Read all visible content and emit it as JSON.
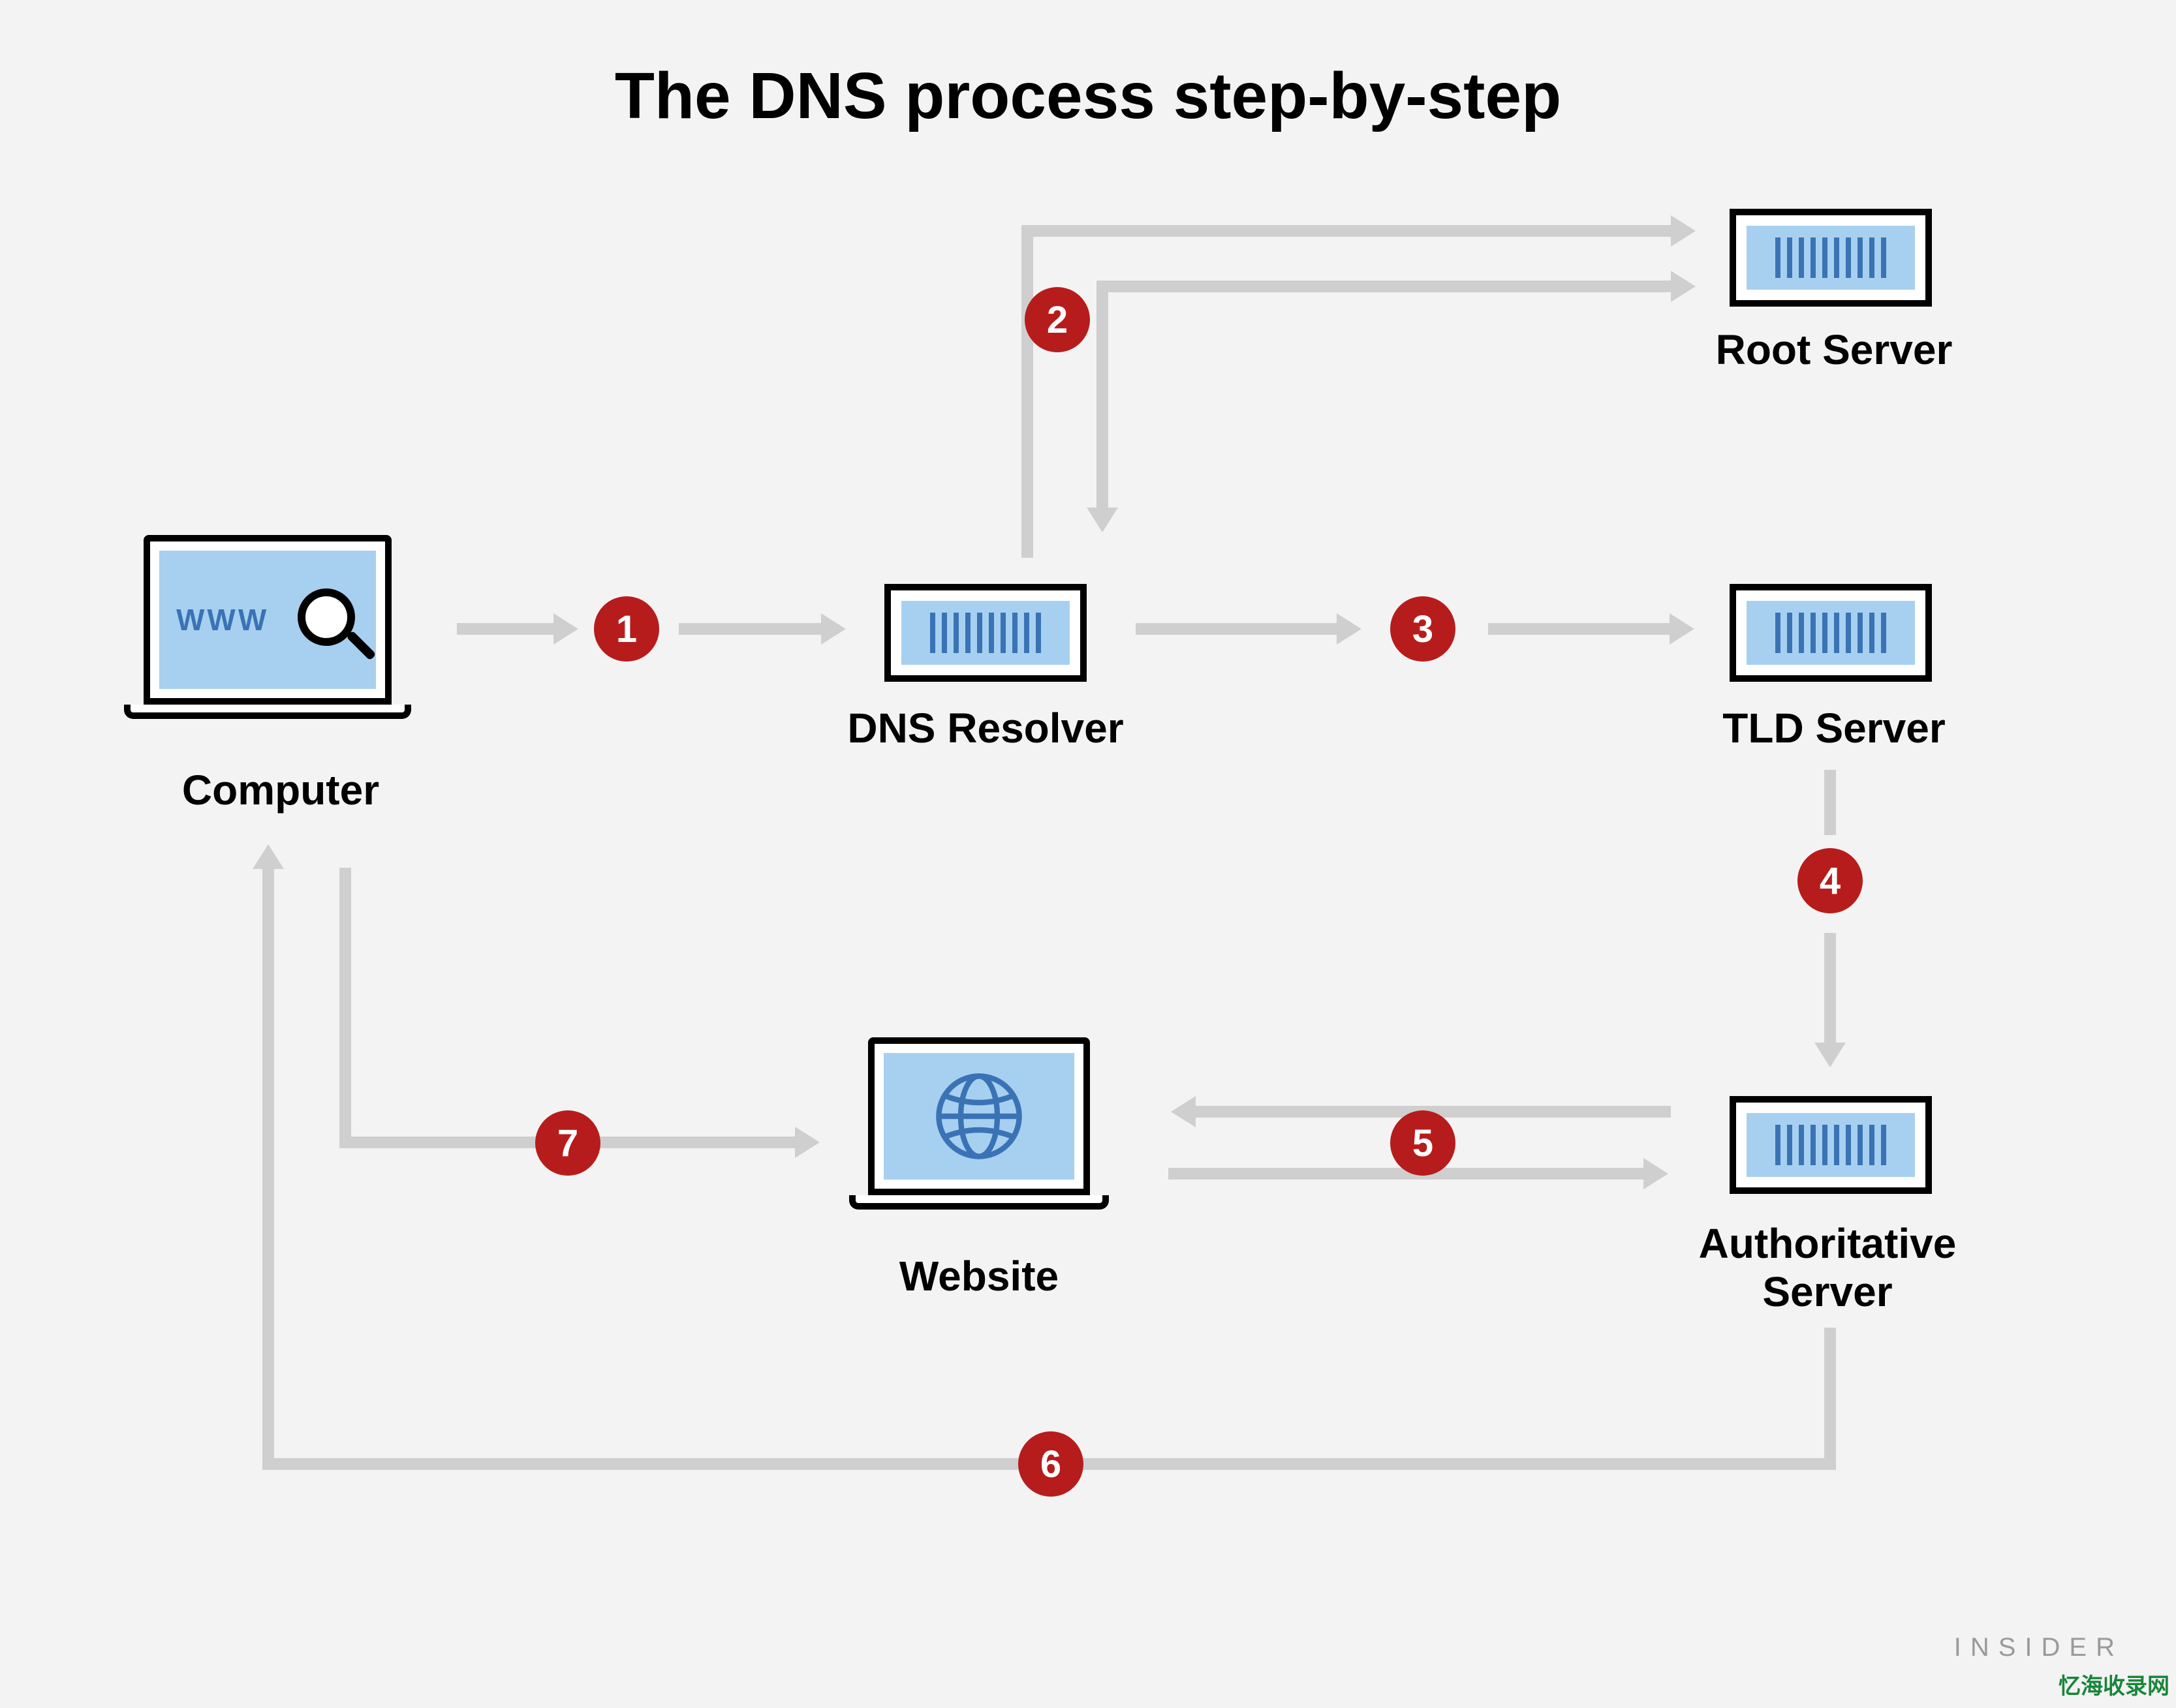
{
  "title": "The DNS process step-by-step",
  "nodes": {
    "computer": "Computer",
    "dns_resolver": "DNS Resolver",
    "root_server": "Root Server",
    "tld_server": "TLD Server",
    "auth_server": "Authoritative\nServer",
    "website": "Website"
  },
  "steps": {
    "s1": "1",
    "s2": "2",
    "s3": "3",
    "s4": "4",
    "s5": "5",
    "s6": "6",
    "s7": "7"
  },
  "computer_screen_text": "WWW",
  "attribution": "INSIDER",
  "watermark": "忆海收录网",
  "icons": {
    "magnifier": "magnifier-icon",
    "globe": "globe-icon",
    "server_bars": "server-bars-icon"
  },
  "colors": {
    "badge": "#b71c1c",
    "arrow": "#cfcfcf",
    "screen_blue": "#a7d0f0",
    "bar_blue": "#3a73b5",
    "bg": "#f3f3f3"
  }
}
